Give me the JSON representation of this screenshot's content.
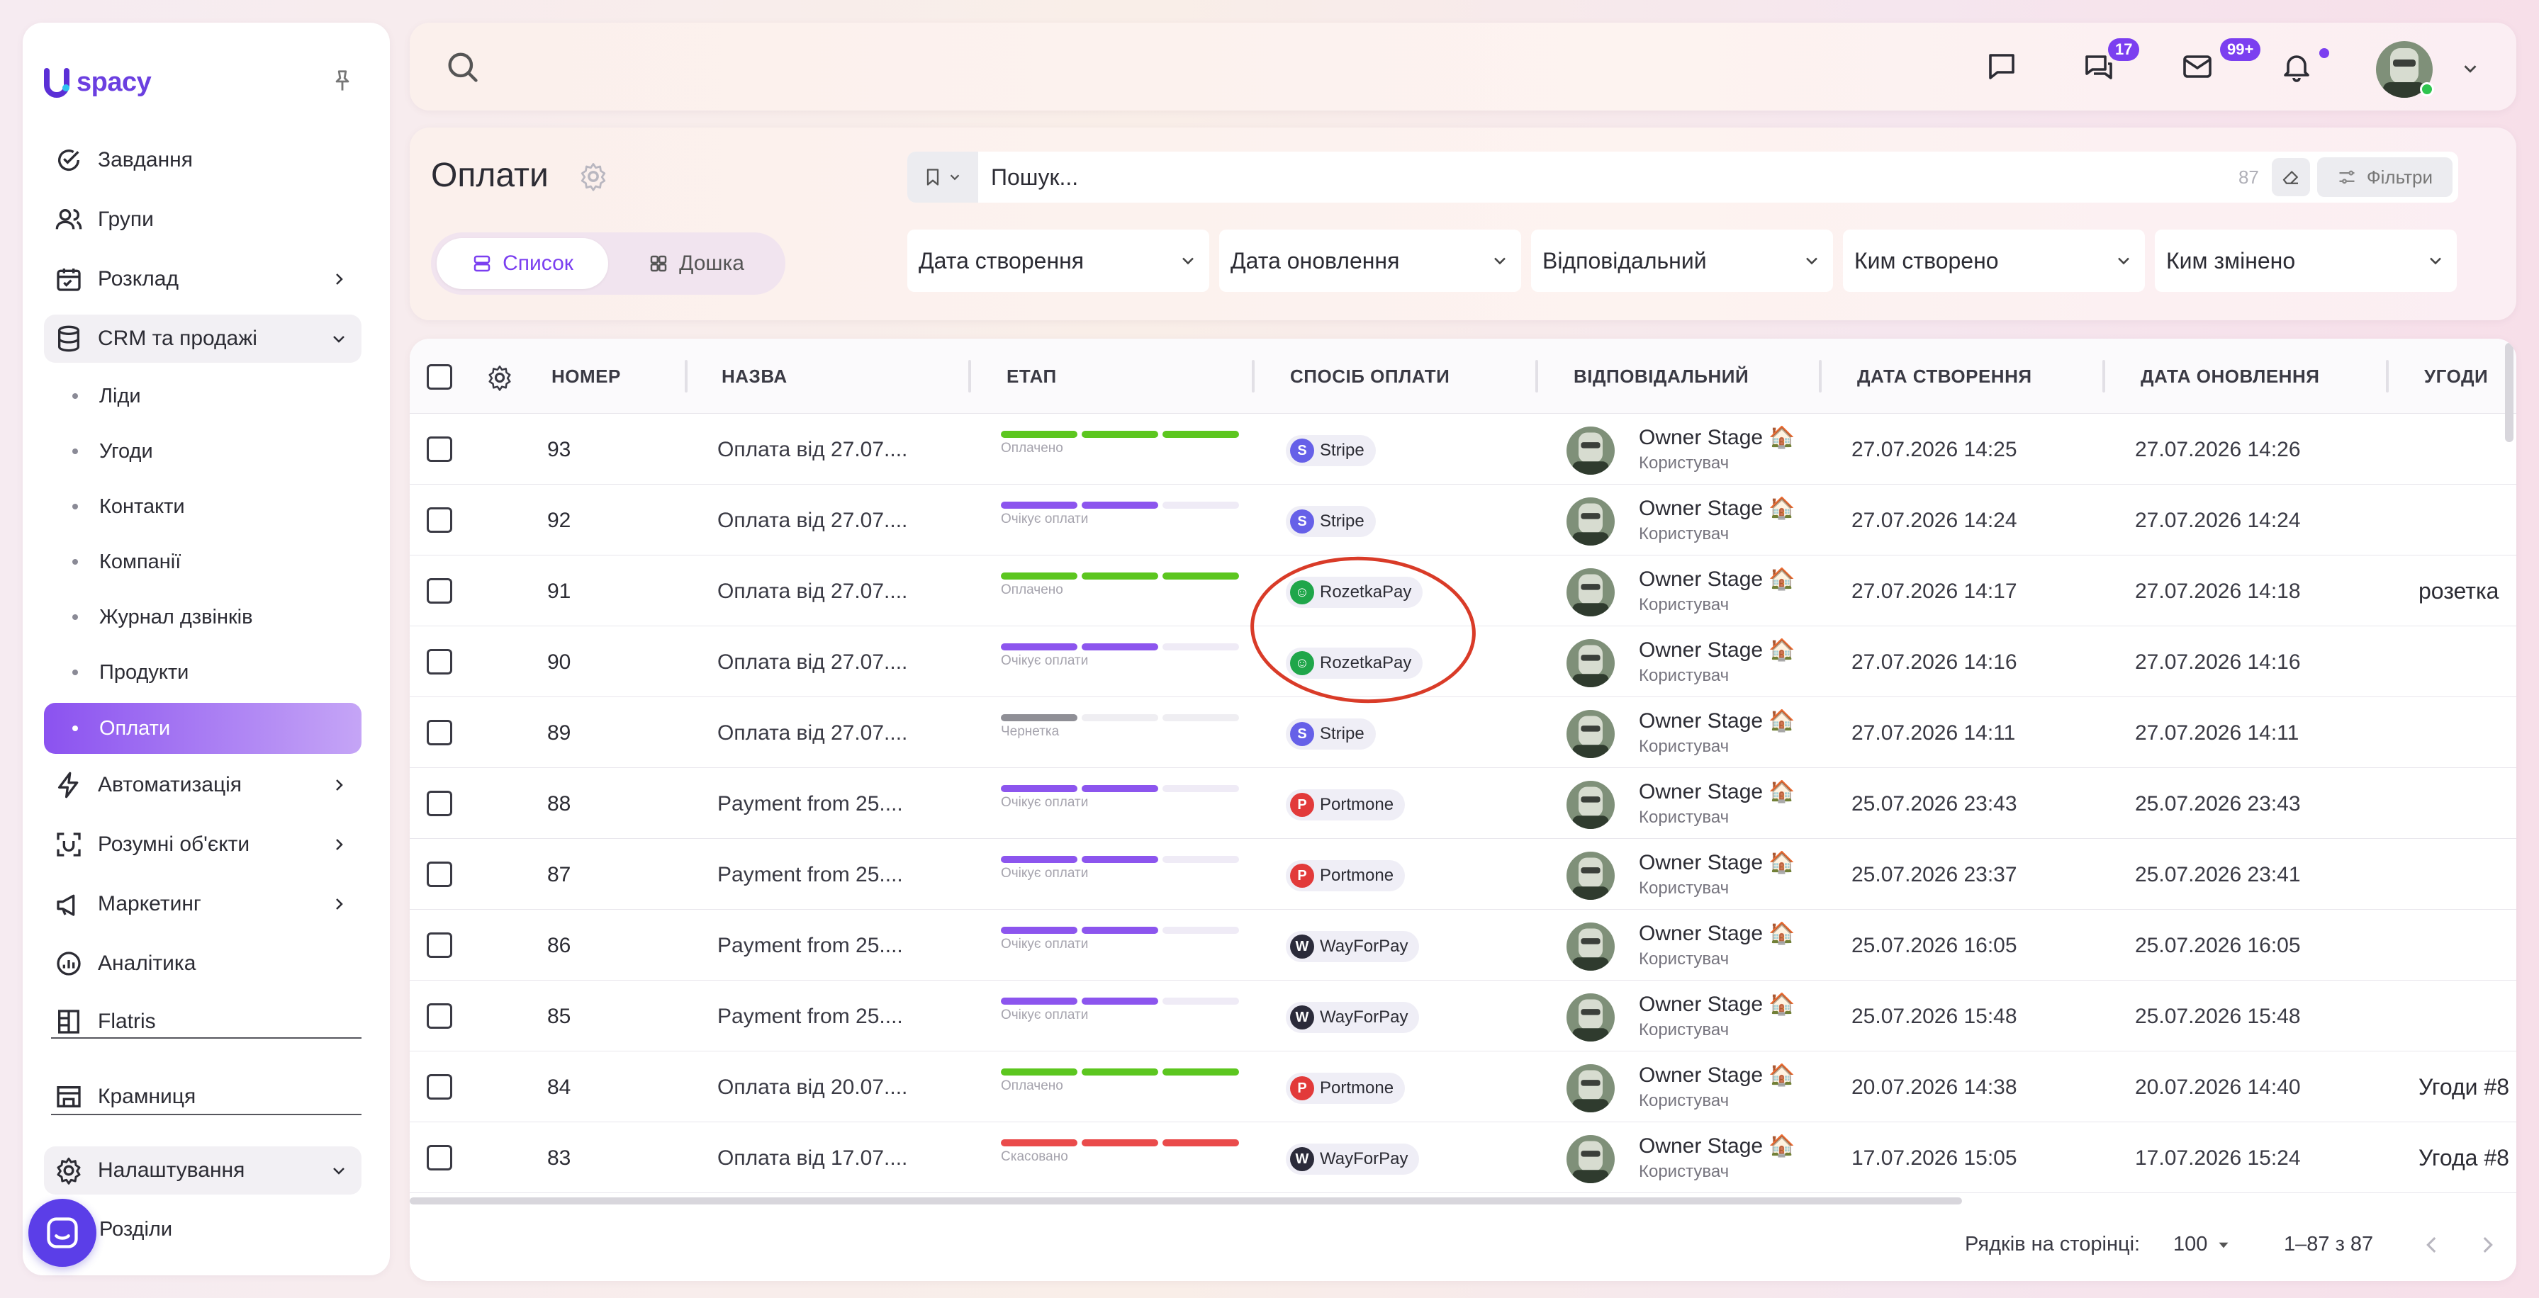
{
  "sidebar": {
    "logo_text": "spacy",
    "items": [
      {
        "label": "Завдання",
        "icon": "check-circle-icon"
      },
      {
        "label": "Групи",
        "icon": "users-icon"
      },
      {
        "label": "Розклад",
        "icon": "calendar-icon"
      },
      {
        "label": "CRM та продажі",
        "icon": "database-icon"
      },
      {
        "label": "Автоматизація",
        "icon": "lightning-icon"
      },
      {
        "label": "Розумні об'єкти",
        "icon": "scan-icon"
      },
      {
        "label": "Маркетинг",
        "icon": "megaphone-icon"
      },
      {
        "label": "Аналітика",
        "icon": "chart-icon"
      },
      {
        "label": "Flatris",
        "icon": "grid-icon"
      },
      {
        "label": "Крамниця",
        "icon": "store-icon"
      },
      {
        "label": "Налаштування",
        "icon": "gear-icon"
      }
    ],
    "crm_sub": [
      "Ліди",
      "Угоди",
      "Контакти",
      "Компанії",
      "Журнал дзвінків",
      "Продукти",
      "Оплати"
    ],
    "settings_sub": [
      "Розділи"
    ]
  },
  "topbar": {
    "chat_badge": "17",
    "mail_badge": "99+"
  },
  "header": {
    "title": "Оплати",
    "view_list": "Список",
    "view_board": "Дошка",
    "search_placeholder": "Пошук...",
    "search_count": "87",
    "filters_label": "Фільтри",
    "filter_selects": [
      "Дата створення",
      "Дата оновлення",
      "Відповідальний",
      "Ким створено",
      "Ким змінено"
    ]
  },
  "table": {
    "columns": [
      "НОМЕР",
      "НАЗВА",
      "ЕТАП",
      "СПОСІБ ОПЛАТИ",
      "ВІДПОВІДАЛЬНИЙ",
      "ДАТА СТВОРЕННЯ",
      "ДАТА ОНОВЛЕННЯ",
      "УГОДИ"
    ],
    "rows": [
      {
        "num": "93",
        "name": "Оплата від 27.07....",
        "stage": "Оплачено",
        "method": "Stripe",
        "user": "Owner Stage 🏠",
        "role": "Користувач",
        "created": "27.07.2026 14:25",
        "updated": "27.07.2026 14:26",
        "deals": ""
      },
      {
        "num": "92",
        "name": "Оплата від 27.07....",
        "stage": "Очікує оплати",
        "method": "Stripe",
        "user": "Owner Stage 🏠",
        "role": "Користувач",
        "created": "27.07.2026 14:24",
        "updated": "27.07.2026 14:24",
        "deals": ""
      },
      {
        "num": "91",
        "name": "Оплата від 27.07....",
        "stage": "Оплачено",
        "method": "RozetkaPay",
        "user": "Owner Stage 🏠",
        "role": "Користувач",
        "created": "27.07.2026 14:17",
        "updated": "27.07.2026 14:18",
        "deals": "розетка"
      },
      {
        "num": "90",
        "name": "Оплата від 27.07....",
        "stage": "Очікує оплати",
        "method": "RozetkaPay",
        "user": "Owner Stage 🏠",
        "role": "Користувач",
        "created": "27.07.2026 14:16",
        "updated": "27.07.2026 14:16",
        "deals": ""
      },
      {
        "num": "89",
        "name": "Оплата від 27.07....",
        "stage": "Чернетка",
        "method": "Stripe",
        "user": "Owner Stage 🏠",
        "role": "Користувач",
        "created": "27.07.2026 14:11",
        "updated": "27.07.2026 14:11",
        "deals": ""
      },
      {
        "num": "88",
        "name": "Payment from 25....",
        "stage": "Очікує оплати",
        "method": "Portmone",
        "user": "Owner Stage 🏠",
        "role": "Користувач",
        "created": "25.07.2026 23:43",
        "updated": "25.07.2026 23:43",
        "deals": ""
      },
      {
        "num": "87",
        "name": "Payment from 25....",
        "stage": "Очікує оплати",
        "method": "Portmone",
        "user": "Owner Stage 🏠",
        "role": "Користувач",
        "created": "25.07.2026 23:37",
        "updated": "25.07.2026 23:41",
        "deals": ""
      },
      {
        "num": "86",
        "name": "Payment from 25....",
        "stage": "Очікує оплати",
        "method": "WayForPay",
        "user": "Owner Stage 🏠",
        "role": "Користувач",
        "created": "25.07.2026 16:05",
        "updated": "25.07.2026 16:05",
        "deals": ""
      },
      {
        "num": "85",
        "name": "Payment from 25....",
        "stage": "Очікує оплати",
        "method": "WayForPay",
        "user": "Owner Stage 🏠",
        "role": "Користувач",
        "created": "25.07.2026 15:48",
        "updated": "25.07.2026 15:48",
        "deals": ""
      },
      {
        "num": "84",
        "name": "Оплата від 20.07....",
        "stage": "Оплачено",
        "method": "Portmone",
        "user": "Owner Stage 🏠",
        "role": "Користувач",
        "created": "20.07.2026 14:38",
        "updated": "20.07.2026 14:40",
        "deals": "Угоди #8"
      },
      {
        "num": "83",
        "name": "Оплата від 17.07....",
        "stage": "Скасовано",
        "method": "WayForPay",
        "user": "Owner Stage 🏠",
        "role": "Користувач",
        "created": "17.07.2026 15:05",
        "updated": "17.07.2026 15:24",
        "deals": "Угода #8"
      }
    ]
  },
  "stage_styles": {
    "Оплачено": {
      "colors": [
        "#5cc61f",
        "#5cc61f",
        "#5cc61f"
      ]
    },
    "Очікує оплати": {
      "colors": [
        "#8c55ee",
        "#8c55ee",
        "#efebf6"
      ]
    },
    "Чернетка": {
      "colors": [
        "#8f8f96",
        "#efeef2",
        "#efeef2"
      ]
    },
    "Скасовано": {
      "colors": [
        "#ea4b4b",
        "#ea4b4b",
        "#ea4b4b"
      ]
    }
  },
  "method_styles": {
    "Stripe": {
      "letter": "S",
      "color": "#6660e8"
    },
    "RozetkaPay": {
      "letter": "☺",
      "color": "#1fa64a"
    },
    "Portmone": {
      "letter": "P",
      "color": "#e23a3a"
    },
    "WayForPay": {
      "letter": "W",
      "color": "#2b2b3a"
    }
  },
  "footer": {
    "rows_per_page_label": "Рядків на сторінці:",
    "rows_per_page_value": "100",
    "range": "1–87 з 87"
  }
}
